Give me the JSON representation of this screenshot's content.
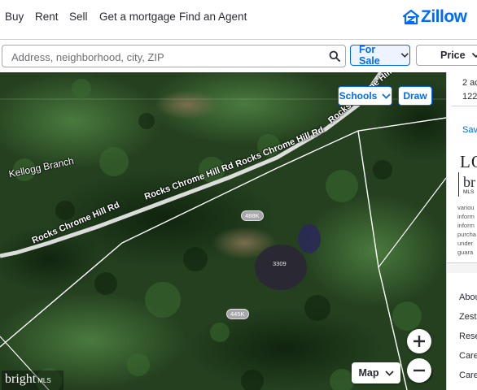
{
  "nav": {
    "links": [
      "Buy",
      "Rent",
      "Sell",
      "Get a mortgage",
      "Find an Agent"
    ],
    "logo_text": "Zillow"
  },
  "search": {
    "placeholder": "Address, neighborhood, city, ZIP",
    "value": "",
    "for_sale_label": "For Sale",
    "price_label": "Price"
  },
  "map": {
    "schools_label": "Schools",
    "draw_label": "Draw",
    "map_type_label": "Map",
    "road_labels": [
      "Rocks Chrome Hill Rd",
      "Rocks Chrome Hill Rd",
      "Rocks Chrome Hill Rd",
      "Rocks Chrome Hill Rd"
    ],
    "place_label": "Kellogg Branch",
    "price_tags": [
      "488K",
      "445K"
    ],
    "lot_number": "3309",
    "watermark": "bright",
    "watermark_mls": "MLS"
  },
  "panel": {
    "facts_line1": "2 ac",
    "facts_line2": "122",
    "save_label": "Save",
    "brand_text": "LO",
    "bright_text": "br",
    "bright_mls": "MLS",
    "disclaimer_lines": [
      "variou",
      "inform",
      "inform",
      "purcha",
      "under",
      "guara"
    ],
    "footer_links": [
      "Abou",
      "Zesti",
      "Rese",
      "Care",
      "Care"
    ]
  },
  "colors": {
    "accent": "#006aff",
    "text": "#2a2a33"
  }
}
